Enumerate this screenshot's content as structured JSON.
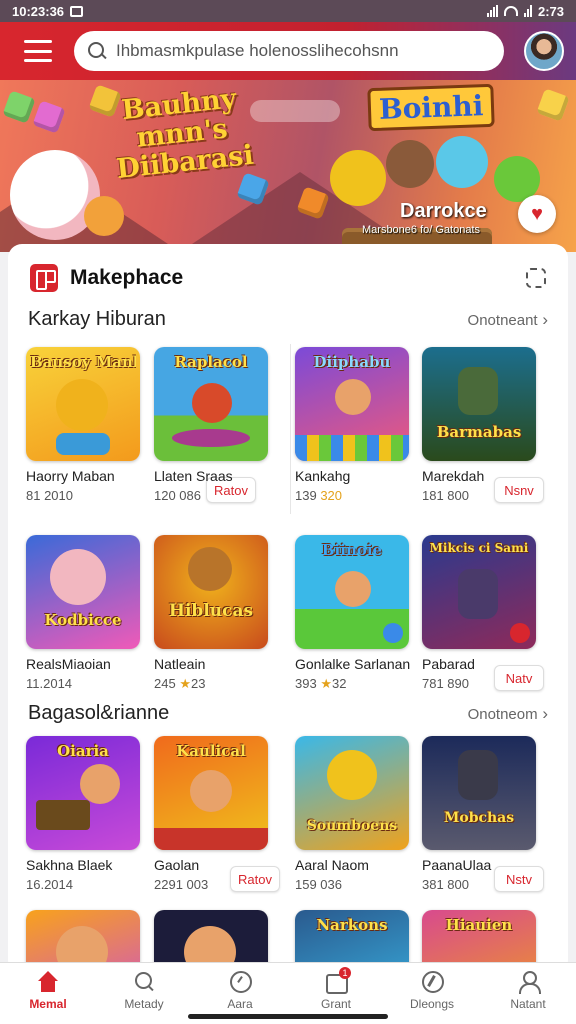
{
  "status_bar": {
    "time": "10:23:36",
    "battery": "2:73"
  },
  "header": {
    "menu_icon": "hamburger-icon",
    "search": {
      "placeholder": "Ihbmasmkpulase holenosslihecohsnn",
      "value": ""
    },
    "avatar_icon": "user-avatar"
  },
  "banner": {
    "title_lines": [
      "Bauhny",
      "mnn's",
      "Diibarasi"
    ],
    "logo": "Boinhi",
    "brand": "Darrokce",
    "tagline": "Marsbone6 fo/ Gatonats",
    "heart_icon": "heart-icon"
  },
  "market": {
    "title": "Makephace",
    "icon": "marketplace-icon",
    "filter_icon": "filter-icon"
  },
  "sections": [
    {
      "title": "Karkay Hiburan",
      "more": "Onotneant",
      "rows": [
        [
          {
            "name": "Haorry Maban",
            "meta": "81 2010",
            "thumb_text": "Bausoy Manba",
            "colors": [
              "#f8c21c",
              "#f39a1c"
            ]
          },
          {
            "name": "Llaten Sraas",
            "meta": "120 086",
            "thumb_text": "Raplacol",
            "colors": [
              "#46a6e3",
              "#6bbf3a"
            ]
          },
          {
            "name": "Kankahg",
            "meta": "139 ",
            "meta_stars": "320",
            "thumb_text": "Diiphabu",
            "colors": [
              "#7b4ad8",
              "#f05a7a"
            ]
          },
          {
            "name": "Marekdah",
            "meta": "181 800",
            "thumb_text": "Barmabas",
            "colors": [
              "#1c6e8e",
              "#3a3a1c"
            ],
            "get": "Nsnv"
          }
        ],
        [
          {
            "name": "RealsMiaoian",
            "meta": "11.2014",
            "thumb_text": "Kodbicce",
            "colors": [
              "#3a6ad8",
              "#f05ab8"
            ]
          },
          {
            "name": "Natleain",
            "meta": "245 ",
            "meta_stars": "23",
            "thumb_text": "Hiblucas",
            "colors": [
              "#c84a1c",
              "#f0b21c"
            ]
          },
          {
            "name": "Gonlalke Sarlanan",
            "meta": "393 ",
            "meta_stars": "32",
            "thumb_text": "Biinoie",
            "colors": [
              "#3ab8e8",
              "#5ac83a"
            ]
          },
          {
            "name": "Pabarad",
            "meta": "781 890",
            "thumb_text": "Mikcis ci Sami",
            "colors": [
              "#2a3a8e",
              "#8e2a5a"
            ],
            "get": "Natv"
          }
        ]
      ],
      "first_get": "Ratov"
    },
    {
      "title": "Bagasol&rianne",
      "more": "Onotneom",
      "rows": [
        [
          {
            "name": "Sakhna Blaek",
            "meta": "16.2014",
            "thumb_text": "Oiaria",
            "colors": [
              "#7a2ad8",
              "#f0c21c"
            ]
          },
          {
            "name": "Gaolan",
            "meta": "2291 003",
            "thumb_text": "Kaulical",
            "colors": [
              "#f06a1c",
              "#f0c21c"
            ],
            "get": "Ratov"
          },
          {
            "name": "Aaral Naom",
            "meta": "159 036",
            "thumb_text": "Soumboens",
            "colors": [
              "#3ab8e8",
              "#f0a21c"
            ]
          },
          {
            "name": "PaanaUlaa",
            "meta": "381 800",
            "thumb_text": "Mobchas",
            "colors": [
              "#1c2a5a",
              "#5a5a6e"
            ],
            "get": "Nstv"
          }
        ]
      ]
    }
  ],
  "partial_row": [
    "#f8a21c",
    "#1c1c3a",
    "#2a5a8e",
    "#d84a8e"
  ],
  "partial_texts": [
    "",
    "",
    "Narkons",
    "Hiauien"
  ],
  "bottom_nav": [
    {
      "label": "Memal",
      "icon": "home-icon",
      "active": true
    },
    {
      "label": "Metady",
      "icon": "search-icon",
      "active": false
    },
    {
      "label": "Aara",
      "icon": "clock-icon",
      "active": false
    },
    {
      "label": "Grant",
      "icon": "cart-icon",
      "active": false,
      "badge": "1"
    },
    {
      "label": "Dleongs",
      "icon": "compass-icon",
      "active": false
    },
    {
      "label": "Natant",
      "icon": "user-icon",
      "active": false
    }
  ]
}
